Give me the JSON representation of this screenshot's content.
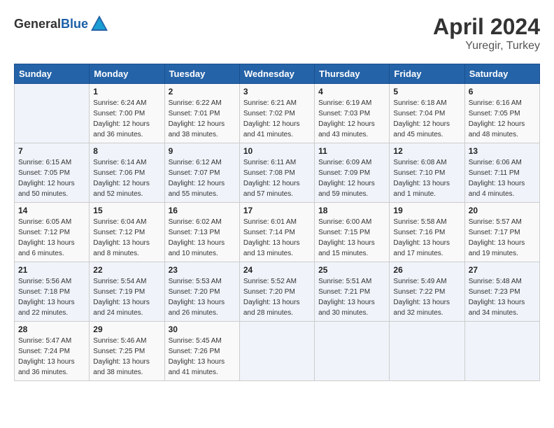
{
  "header": {
    "logo_general": "General",
    "logo_blue": "Blue",
    "month": "April 2024",
    "location": "Yuregir, Turkey"
  },
  "calendar": {
    "columns": [
      "Sunday",
      "Monday",
      "Tuesday",
      "Wednesday",
      "Thursday",
      "Friday",
      "Saturday"
    ],
    "weeks": [
      [
        {
          "day": "",
          "info": ""
        },
        {
          "day": "1",
          "info": "Sunrise: 6:24 AM\nSunset: 7:00 PM\nDaylight: 12 hours\nand 36 minutes."
        },
        {
          "day": "2",
          "info": "Sunrise: 6:22 AM\nSunset: 7:01 PM\nDaylight: 12 hours\nand 38 minutes."
        },
        {
          "day": "3",
          "info": "Sunrise: 6:21 AM\nSunset: 7:02 PM\nDaylight: 12 hours\nand 41 minutes."
        },
        {
          "day": "4",
          "info": "Sunrise: 6:19 AM\nSunset: 7:03 PM\nDaylight: 12 hours\nand 43 minutes."
        },
        {
          "day": "5",
          "info": "Sunrise: 6:18 AM\nSunset: 7:04 PM\nDaylight: 12 hours\nand 45 minutes."
        },
        {
          "day": "6",
          "info": "Sunrise: 6:16 AM\nSunset: 7:05 PM\nDaylight: 12 hours\nand 48 minutes."
        }
      ],
      [
        {
          "day": "7",
          "info": "Sunrise: 6:15 AM\nSunset: 7:05 PM\nDaylight: 12 hours\nand 50 minutes."
        },
        {
          "day": "8",
          "info": "Sunrise: 6:14 AM\nSunset: 7:06 PM\nDaylight: 12 hours\nand 52 minutes."
        },
        {
          "day": "9",
          "info": "Sunrise: 6:12 AM\nSunset: 7:07 PM\nDaylight: 12 hours\nand 55 minutes."
        },
        {
          "day": "10",
          "info": "Sunrise: 6:11 AM\nSunset: 7:08 PM\nDaylight: 12 hours\nand 57 minutes."
        },
        {
          "day": "11",
          "info": "Sunrise: 6:09 AM\nSunset: 7:09 PM\nDaylight: 12 hours\nand 59 minutes."
        },
        {
          "day": "12",
          "info": "Sunrise: 6:08 AM\nSunset: 7:10 PM\nDaylight: 13 hours\nand 1 minute."
        },
        {
          "day": "13",
          "info": "Sunrise: 6:06 AM\nSunset: 7:11 PM\nDaylight: 13 hours\nand 4 minutes."
        }
      ],
      [
        {
          "day": "14",
          "info": "Sunrise: 6:05 AM\nSunset: 7:12 PM\nDaylight: 13 hours\nand 6 minutes."
        },
        {
          "day": "15",
          "info": "Sunrise: 6:04 AM\nSunset: 7:12 PM\nDaylight: 13 hours\nand 8 minutes."
        },
        {
          "day": "16",
          "info": "Sunrise: 6:02 AM\nSunset: 7:13 PM\nDaylight: 13 hours\nand 10 minutes."
        },
        {
          "day": "17",
          "info": "Sunrise: 6:01 AM\nSunset: 7:14 PM\nDaylight: 13 hours\nand 13 minutes."
        },
        {
          "day": "18",
          "info": "Sunrise: 6:00 AM\nSunset: 7:15 PM\nDaylight: 13 hours\nand 15 minutes."
        },
        {
          "day": "19",
          "info": "Sunrise: 5:58 AM\nSunset: 7:16 PM\nDaylight: 13 hours\nand 17 minutes."
        },
        {
          "day": "20",
          "info": "Sunrise: 5:57 AM\nSunset: 7:17 PM\nDaylight: 13 hours\nand 19 minutes."
        }
      ],
      [
        {
          "day": "21",
          "info": "Sunrise: 5:56 AM\nSunset: 7:18 PM\nDaylight: 13 hours\nand 22 minutes."
        },
        {
          "day": "22",
          "info": "Sunrise: 5:54 AM\nSunset: 7:19 PM\nDaylight: 13 hours\nand 24 minutes."
        },
        {
          "day": "23",
          "info": "Sunrise: 5:53 AM\nSunset: 7:20 PM\nDaylight: 13 hours\nand 26 minutes."
        },
        {
          "day": "24",
          "info": "Sunrise: 5:52 AM\nSunset: 7:20 PM\nDaylight: 13 hours\nand 28 minutes."
        },
        {
          "day": "25",
          "info": "Sunrise: 5:51 AM\nSunset: 7:21 PM\nDaylight: 13 hours\nand 30 minutes."
        },
        {
          "day": "26",
          "info": "Sunrise: 5:49 AM\nSunset: 7:22 PM\nDaylight: 13 hours\nand 32 minutes."
        },
        {
          "day": "27",
          "info": "Sunrise: 5:48 AM\nSunset: 7:23 PM\nDaylight: 13 hours\nand 34 minutes."
        }
      ],
      [
        {
          "day": "28",
          "info": "Sunrise: 5:47 AM\nSunset: 7:24 PM\nDaylight: 13 hours\nand 36 minutes."
        },
        {
          "day": "29",
          "info": "Sunrise: 5:46 AM\nSunset: 7:25 PM\nDaylight: 13 hours\nand 38 minutes."
        },
        {
          "day": "30",
          "info": "Sunrise: 5:45 AM\nSunset: 7:26 PM\nDaylight: 13 hours\nand 41 minutes."
        },
        {
          "day": "",
          "info": ""
        },
        {
          "day": "",
          "info": ""
        },
        {
          "day": "",
          "info": ""
        },
        {
          "day": "",
          "info": ""
        }
      ]
    ]
  }
}
